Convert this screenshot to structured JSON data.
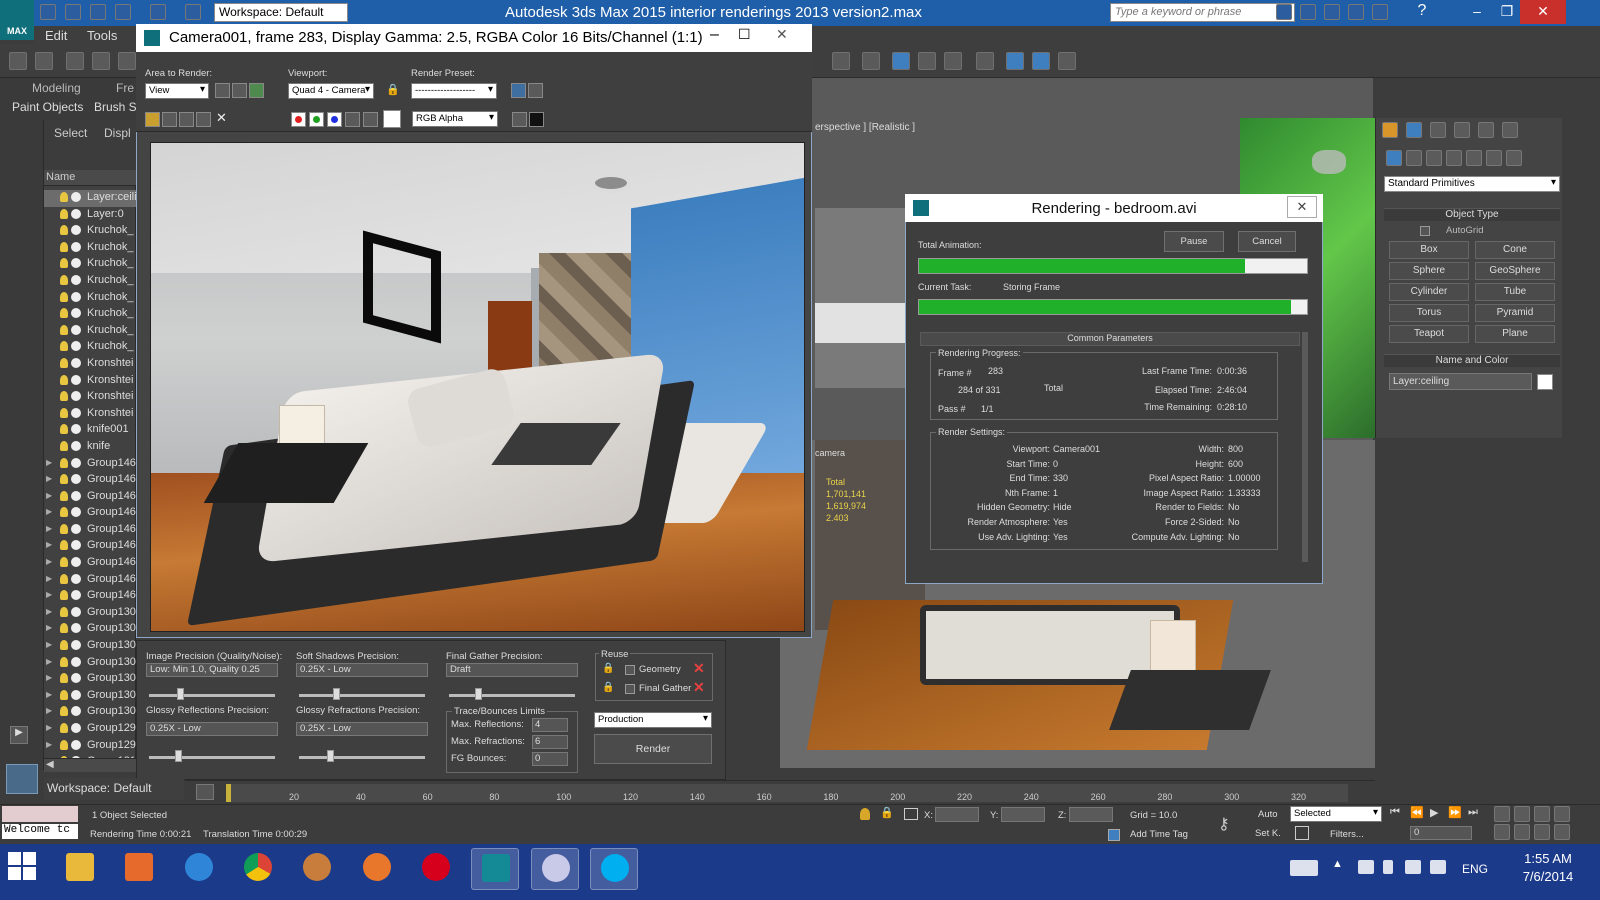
{
  "app": {
    "title": "Autodesk 3ds Max  2015     interior renderings 2013 version2.max",
    "logo_text": "MAX",
    "workspace": "Workspace: Default",
    "search_placeholder": "Type a keyword or phrase"
  },
  "menu": {
    "edit": "Edit",
    "tools": "Tools"
  },
  "ribbon": {
    "modeling": "Modeling",
    "freeform": "Fre",
    "paint_objects": "Paint Objects",
    "brush": "Brush S"
  },
  "explorer": {
    "select_label": "Select",
    "display_label": "Displ",
    "column": "Name",
    "rows": [
      {
        "name": "Layer:ceili",
        "expand": false,
        "selected": true
      },
      {
        "name": "Layer:0",
        "expand": false
      },
      {
        "name": "Kruchok_",
        "expand": false
      },
      {
        "name": "Kruchok_",
        "expand": false
      },
      {
        "name": "Kruchok_",
        "expand": false
      },
      {
        "name": "Kruchok_",
        "expand": false
      },
      {
        "name": "Kruchok_",
        "expand": false
      },
      {
        "name": "Kruchok_",
        "expand": false
      },
      {
        "name": "Kruchok_",
        "expand": false
      },
      {
        "name": "Kruchok_",
        "expand": false
      },
      {
        "name": "Kronshtei",
        "expand": false
      },
      {
        "name": "Kronshtei",
        "expand": false
      },
      {
        "name": "Kronshtei",
        "expand": false
      },
      {
        "name": "Kronshtei",
        "expand": false
      },
      {
        "name": "knife001",
        "expand": false
      },
      {
        "name": "knife",
        "expand": false
      },
      {
        "name": "Group146",
        "expand": true
      },
      {
        "name": "Group146",
        "expand": true
      },
      {
        "name": "Group146",
        "expand": true
      },
      {
        "name": "Group146",
        "expand": true
      },
      {
        "name": "Group146",
        "expand": true
      },
      {
        "name": "Group146",
        "expand": true
      },
      {
        "name": "Group146",
        "expand": true
      },
      {
        "name": "Group146",
        "expand": true
      },
      {
        "name": "Group146",
        "expand": true
      },
      {
        "name": "Group130",
        "expand": true
      },
      {
        "name": "Group130",
        "expand": true
      },
      {
        "name": "Group130",
        "expand": true
      },
      {
        "name": "Group130",
        "expand": true
      },
      {
        "name": "Group130",
        "expand": true
      },
      {
        "name": "Group130",
        "expand": true
      },
      {
        "name": "Group130",
        "expand": true
      },
      {
        "name": "Group129",
        "expand": true
      },
      {
        "name": "Group129",
        "expand": true
      },
      {
        "name": "Group121",
        "expand": true
      }
    ]
  },
  "viewport": {
    "top_label": "erspective ] [Realistic ]",
    "mid_text": [
      "Total",
      "1,701,141",
      "1,619,974",
      "",
      "2.403"
    ],
    "mid_label": "camera"
  },
  "command_panel": {
    "dropdown": "Standard Primitives",
    "object_type": "Object Type",
    "autogrid": "AutoGrid",
    "buttons": [
      "Box",
      "Cone",
      "Sphere",
      "GeoSphere",
      "Cylinder",
      "Tube",
      "Torus",
      "Pyramid",
      "Teapot",
      "Plane"
    ],
    "name_and_color": "Name and Color",
    "name_value": "Layer:ceiling"
  },
  "frame_window": {
    "title": "Camera001, frame 283, Display Gamma: 2.5, RGBA Color 16 Bits/Channel (1:1)",
    "area_label": "Area to Render:",
    "area_value": "View",
    "viewport_label": "Viewport:",
    "viewport_value": "Quad 4 - Camera",
    "preset_label": "Render Preset:",
    "preset_value": "-------------------",
    "channel_value": "RGB Alpha"
  },
  "settings": {
    "image_precision_label": "Image Precision (Quality/Noise):",
    "image_precision_value": "Low: Min 1.0, Quality 0.25",
    "soft_shadows_label": "Soft Shadows Precision:",
    "soft_shadows_value": "0.25X - Low",
    "final_gather_label": "Final Gather Precision:",
    "final_gather_value": "Draft",
    "glossy_refl_label": "Glossy Reflections Precision:",
    "glossy_refl_value": "0.25X - Low",
    "glossy_refr_label": "Glossy Refractions Precision:",
    "glossy_refr_value": "0.25X - Low",
    "reuse_label": "Reuse",
    "geometry_label": "Geometry",
    "final_gather_chk": "Final Gather",
    "trace_label": "Trace/Bounces Limits",
    "max_refl_label": "Max. Reflections:",
    "max_refl_value": "4",
    "max_refr_label": "Max. Refractions:",
    "max_refr_value": "6",
    "fg_bounces_label": "FG Bounces:",
    "fg_bounces_value": "0",
    "mode_value": "Production",
    "render_label": "Render"
  },
  "rendering_dialog": {
    "title": "Rendering - bedroom.avi",
    "total_animation": "Total Animation:",
    "pause": "Pause",
    "cancel": "Cancel",
    "current_task_label": "Current Task:",
    "current_task_value": "Storing Frame",
    "total_progress": 0.84,
    "task_progress": 0.96,
    "common_params": "Common Parameters",
    "progress_label": "Rendering Progress:",
    "frame_label": "Frame #",
    "frame_value": "283",
    "frames_done": "284  of  331",
    "total_label": "Total",
    "pass_label": "Pass #",
    "pass_value": "1/1",
    "last_frame_label": "Last Frame Time:",
    "last_frame_value": "0:00:36",
    "elapsed_label": "Elapsed Time:",
    "elapsed_value": "2:46:04",
    "remaining_label": "Time Remaining:",
    "remaining_value": "0:28:10",
    "settings_label": "Render Settings:",
    "left": [
      {
        "k": "Viewport:",
        "v": "Camera001"
      },
      {
        "k": "Start Time:",
        "v": "0"
      },
      {
        "k": "End Time:",
        "v": "330"
      },
      {
        "k": "Nth Frame:",
        "v": "1"
      },
      {
        "k": "Hidden Geometry:",
        "v": "Hide"
      },
      {
        "k": "Render Atmosphere:",
        "v": "Yes"
      },
      {
        "k": "Use Adv. Lighting:",
        "v": "Yes"
      }
    ],
    "right": [
      {
        "k": "Width:",
        "v": "800"
      },
      {
        "k": "Height:",
        "v": "600"
      },
      {
        "k": "Pixel Aspect Ratio:",
        "v": "1.00000"
      },
      {
        "k": "Image Aspect Ratio:",
        "v": "1.33333"
      },
      {
        "k": "Render to Fields:",
        "v": "No"
      },
      {
        "k": "Force 2-Sided:",
        "v": "No"
      },
      {
        "k": "Compute Adv. Lighting:",
        "v": "No"
      }
    ]
  },
  "timeline": {
    "workspace": "Workspace: Default",
    "ticks": [
      "20",
      "40",
      "60",
      "80",
      "100",
      "120",
      "140",
      "160",
      "180",
      "200",
      "220",
      "240",
      "260",
      "280",
      "300",
      "320"
    ]
  },
  "status": {
    "welcome": "Welcome tc",
    "selected": "1 Object Selected",
    "rendering_time": "Rendering Time  0:00:21",
    "translation_time": "Translation Time  0:00:29",
    "x_label": "X:",
    "y_label": "Y:",
    "z_label": "Z:",
    "grid": "Grid = 10.0",
    "add_time_tag": "Add Time Tag",
    "auto": "Auto",
    "set_k": "Set K.",
    "selected_dropdown": "Selected",
    "filters": "Filters...",
    "frame_field": "0"
  },
  "taskbar": {
    "lang": "ENG",
    "time": "1:55 AM",
    "date": "7/6/2014"
  }
}
